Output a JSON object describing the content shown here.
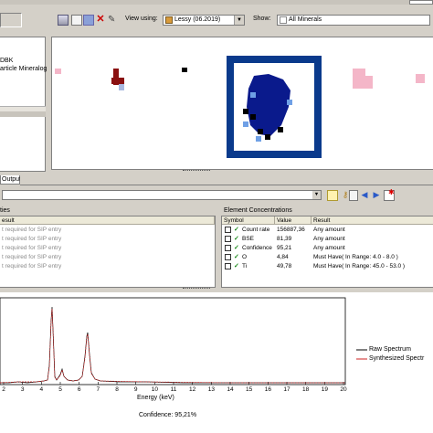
{
  "toolbar": {
    "view_using_label": "View using:",
    "view_using_value": "Lessy (06.2019)",
    "show_label": "Show:",
    "show_value": "All Minerals"
  },
  "left_panel": {
    "items": [
      "DBK",
      "article Mineralog"
    ]
  },
  "tabs": {
    "output_label": "Output"
  },
  "properties_panel": {
    "title": "ties",
    "column_header": "esult",
    "rows": [
      "t required for SIP entry",
      "t required for SIP entry",
      "t required for SIP entry",
      "t required for SIP entry",
      "t required for SIP entry"
    ]
  },
  "element_concentrations": {
    "title": "Element Concentrations",
    "columns": [
      "Symbol",
      "Value",
      "Result"
    ],
    "rows": [
      {
        "symbol": "Count rate",
        "value": "156887,36",
        "result": "Any amount"
      },
      {
        "symbol": "BSE",
        "value": "81,39",
        "result": "Any amount"
      },
      {
        "symbol": "Confidence",
        "value": "95,21",
        "result": "Any amount"
      },
      {
        "symbol": "O",
        "value": "4,84",
        "result": "Must Have( In Range: 4.0 - 8.0 )"
      },
      {
        "symbol": "Ti",
        "value": "49,78",
        "result": "Must Have( In Range: 45.0 - 53.0 )"
      }
    ]
  },
  "spectrum": {
    "x_ticks": [
      "2",
      "3",
      "4",
      "5",
      "6",
      "7",
      "8",
      "9",
      "10",
      "11",
      "12",
      "13",
      "14",
      "15",
      "16",
      "17",
      "18",
      "19",
      "20"
    ],
    "xlabel": "Energy (keV)",
    "confidence": "Confidence: 95,21%",
    "legend": [
      {
        "name": "Raw Spectrum",
        "color": "#000000"
      },
      {
        "name": "Synthesized Spectr",
        "color": "#cc2222"
      }
    ]
  },
  "colors": {
    "particle_blue": "#0a1a8c",
    "particle_border": "#0a3a8c",
    "highlight_pink": "#f4b6c8",
    "dark_red": "#8a1010"
  }
}
